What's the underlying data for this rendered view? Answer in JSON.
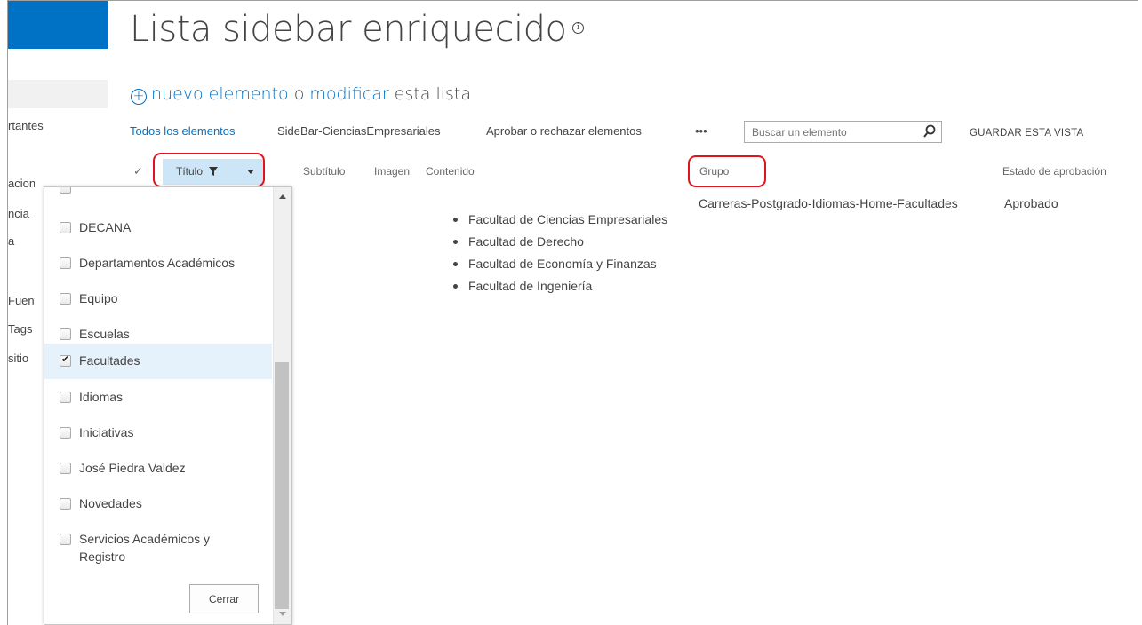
{
  "page": {
    "title": "Lista sidebar enriquecido",
    "info_icon": "ⓘ"
  },
  "leftnav": {
    "items": [
      "rtantes",
      "acion",
      "ncia",
      "a",
      "Fuent",
      "Tags",
      "sitio"
    ]
  },
  "actions": {
    "plus_icon": "+",
    "new_item": "nuevo elemento",
    "or": " o ",
    "edit": "modificar",
    "this_list": " esta lista"
  },
  "views": {
    "all_items": "Todos los elementos",
    "sidebar": "SideBar-CienciasEmpresariales",
    "approve": "Aprobar o rechazar elementos",
    "more": "•••"
  },
  "search": {
    "placeholder": "Buscar un elemento"
  },
  "save_view": "GUARDAR ESTA VISTA",
  "columns": {
    "check": "✓",
    "titulo": "Título",
    "subtitulo": "Subtítulo",
    "imagen": "Imagen",
    "contenido": "Contenido",
    "grupo": "Grupo",
    "estado": "Estado de aprobación"
  },
  "row": {
    "contenido": [
      "Facultad de Ciencias Empresariales",
      "Facultad de Derecho",
      "Facultad de Economía y Finanzas",
      "Facultad de Ingeniería"
    ],
    "grupo": "Carreras-Postgrado-Idiomas-Home-Facultades",
    "estado": "Aprobado"
  },
  "filter": {
    "options": [
      {
        "label": "DECANA",
        "checked": false
      },
      {
        "label": "Departamentos Académicos",
        "checked": false
      },
      {
        "label": "Equipo",
        "checked": false
      },
      {
        "label": "Escuelas",
        "checked": false
      },
      {
        "label": "Facultades",
        "checked": true
      },
      {
        "label": "Idiomas",
        "checked": false
      },
      {
        "label": "Iniciativas",
        "checked": false
      },
      {
        "label": "José Piedra Valdez",
        "checked": false
      },
      {
        "label": "Novedades",
        "checked": false
      },
      {
        "label": "Servicios Académicos y",
        "label2": "Registro",
        "checked": false
      }
    ],
    "close_label": "Cerrar"
  }
}
